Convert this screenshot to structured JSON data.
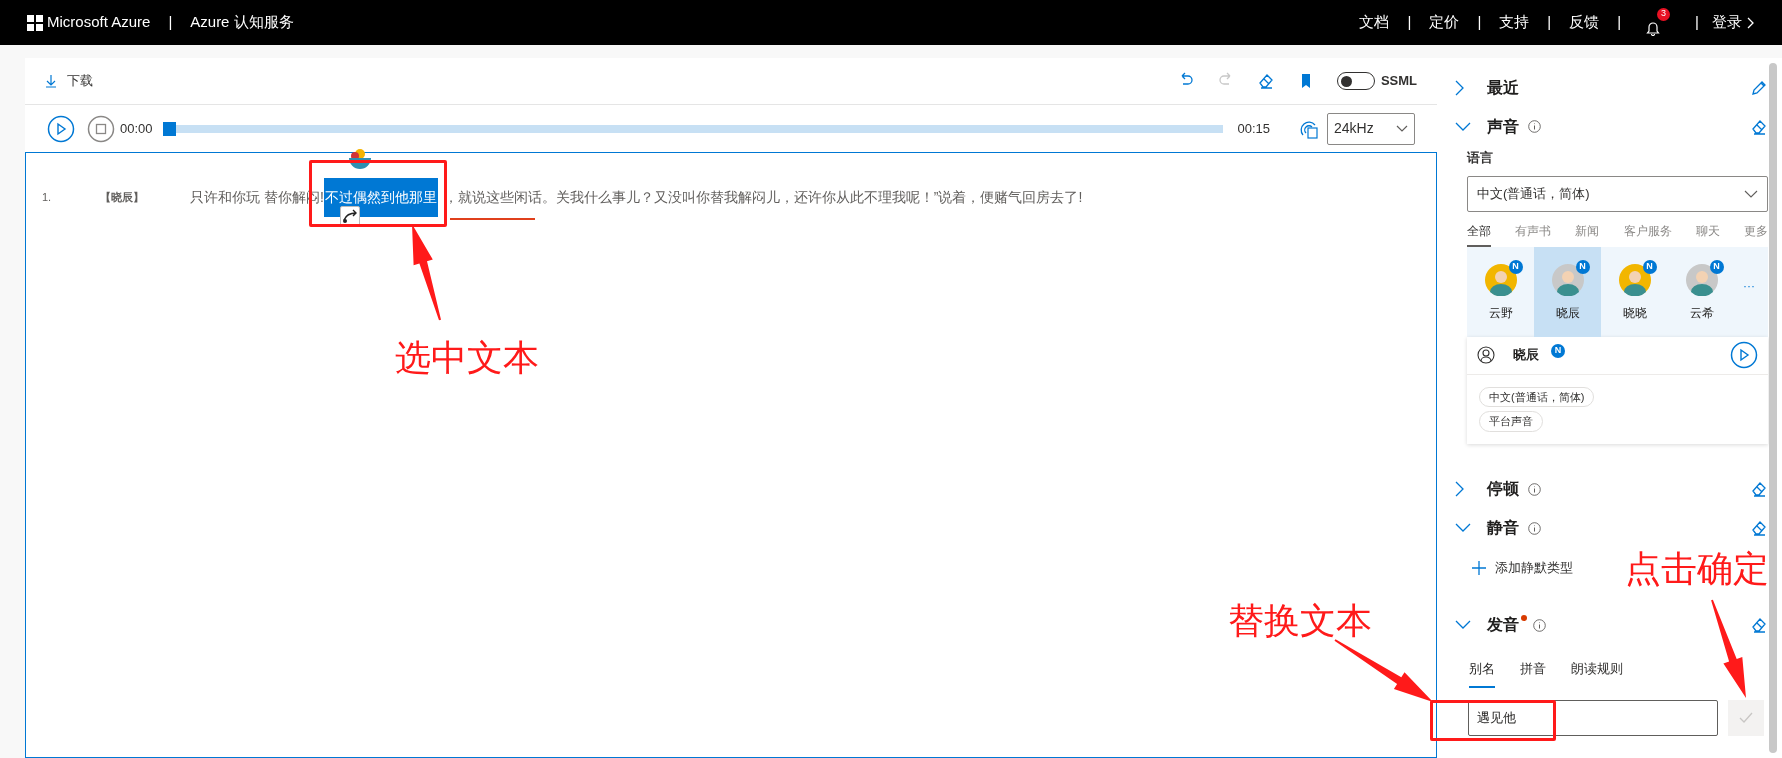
{
  "header": {
    "brand": "Microsoft Azure",
    "separator": "|",
    "product": "Azure 认知服务",
    "links": [
      {
        "label": "文档"
      },
      {
        "label": "定价"
      },
      {
        "label": "支持"
      },
      {
        "label": "反馈"
      }
    ],
    "notification_count": "3",
    "login": "登录"
  },
  "toolbar": {
    "download": "下载",
    "ssml": {
      "label": "SSML",
      "on": false
    }
  },
  "player": {
    "time_start": "00:00",
    "time_end": "00:15",
    "level": 0,
    "sample_rate": "24kHz"
  },
  "editor": {
    "lines": [
      {
        "number": "1.",
        "speaker": "【晓辰】",
        "segments": [
          {
            "text": "只许和你玩 替你解闷!",
            "selected": false
          },
          {
            "text": "不过偶然到他那里",
            "selected": true
          },
          {
            "text": "，就说这些闲话。关我什么事儿？又没叫你替我解闷儿，还许你从此不理我呢！”说着，便赌气回房去了!",
            "selected": false
          }
        ]
      }
    ]
  },
  "panel": {
    "sections": [
      {
        "title": "最近",
        "expanded": false,
        "info": false,
        "modified": false,
        "kind": "recent"
      },
      {
        "title": "声音",
        "expanded": true,
        "info": true,
        "modified": false,
        "kind": "voice"
      },
      {
        "title": "停顿",
        "expanded": false,
        "info": true,
        "modified": false,
        "kind": "pause"
      },
      {
        "title": "静音",
        "expanded": true,
        "info": true,
        "modified": false,
        "kind": "silence"
      },
      {
        "title": "发音",
        "expanded": true,
        "info": true,
        "modified": true,
        "kind": "pronunciation"
      }
    ],
    "voice": {
      "language_label": "语言",
      "language": "中文(普通话，简体)",
      "categories": [
        {
          "label": "全部",
          "selected": true
        },
        {
          "label": "有声书",
          "selected": false
        },
        {
          "label": "新闻",
          "selected": false
        },
        {
          "label": "客户服务",
          "selected": false
        },
        {
          "label": "聊天",
          "selected": false
        },
        {
          "label": "更多",
          "selected": false
        }
      ],
      "voices": [
        {
          "name": "云野",
          "badge": "N",
          "selected": false,
          "color": "#f2b600"
        },
        {
          "name": "晓辰",
          "badge": "N",
          "selected": true,
          "color": "#c8c8c8"
        },
        {
          "name": "晓晓",
          "badge": "N",
          "selected": false,
          "color": "#f2b600"
        },
        {
          "name": "云希",
          "badge": "N",
          "selected": false,
          "color": "#c8c8c8"
        }
      ],
      "more": "···",
      "detail": {
        "name": "晓辰",
        "badge": "N",
        "tags": [
          "中文(普通话，简体)",
          "平台声音"
        ]
      }
    },
    "silence": {
      "add": "添加静默类型"
    },
    "pronunciation": {
      "tabs": [
        {
          "label": "别名",
          "selected": true
        },
        {
          "label": "拼音",
          "selected": false
        },
        {
          "label": "朗读规则",
          "selected": false
        }
      ],
      "value": "遇见他"
    }
  },
  "annotations": [
    {
      "text": "选中文本"
    },
    {
      "text": "替换文本"
    },
    {
      "text": "点击确定"
    }
  ]
}
